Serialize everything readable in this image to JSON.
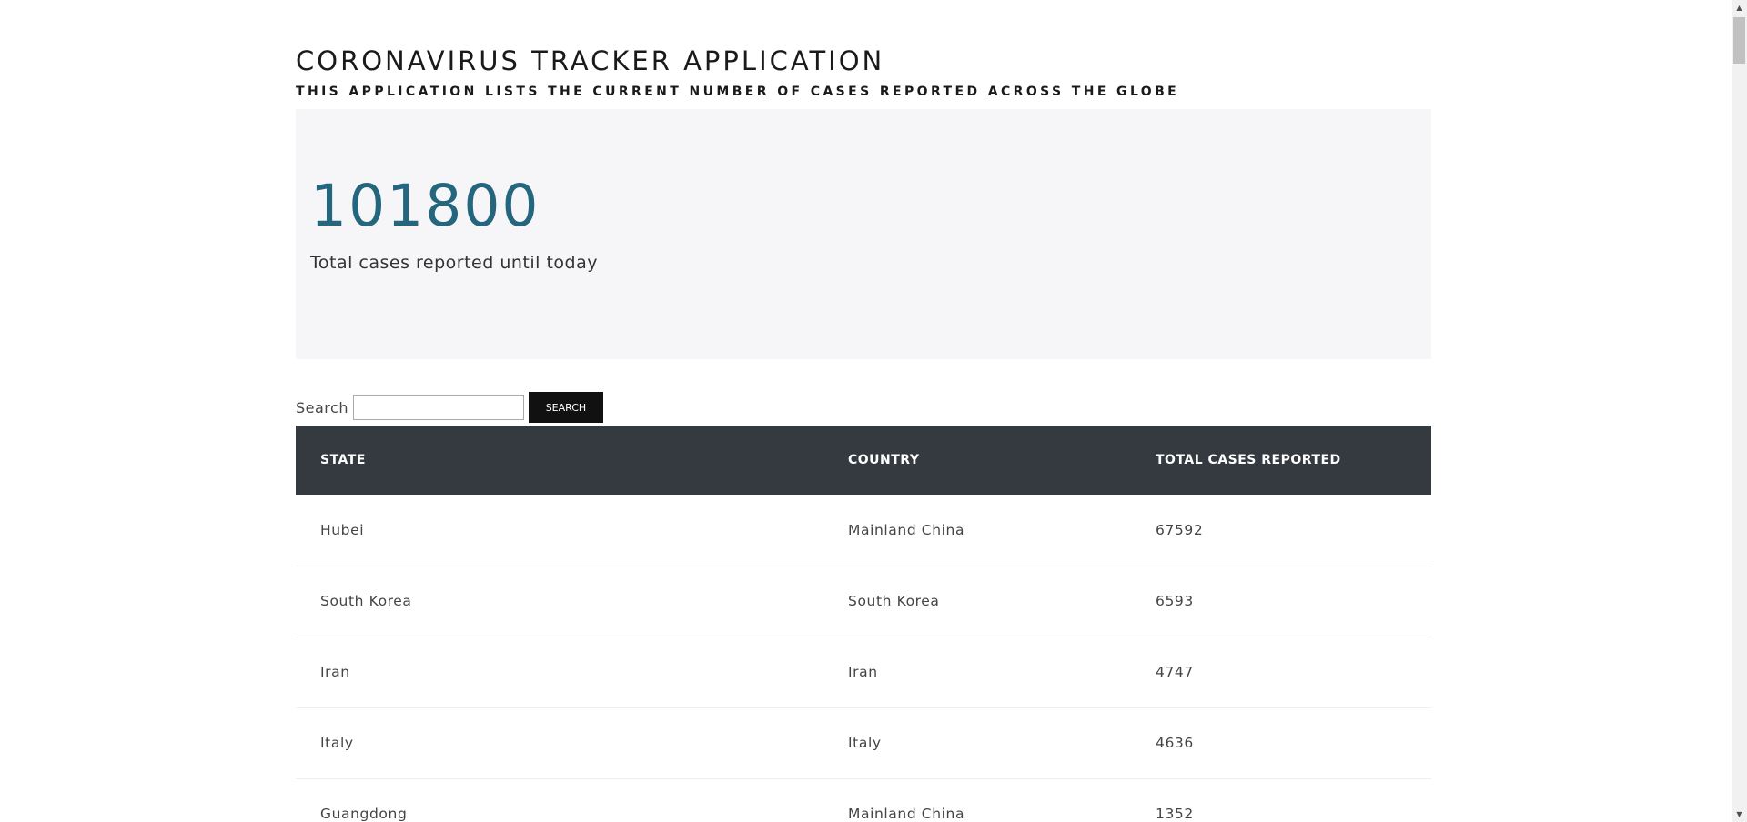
{
  "header": {
    "title": "CORONAVIRUS TRACKER APPLICATION",
    "subtitle": "THIS APPLICATION LISTS THE CURRENT NUMBER OF CASES REPORTED ACROSS THE GLOBE"
  },
  "summary": {
    "total_cases": "101800",
    "total_label": "Total cases reported until today"
  },
  "search": {
    "label": "Search",
    "value": "",
    "placeholder": "",
    "button_label": "SEARCH"
  },
  "table": {
    "headers": {
      "state": "STATE",
      "country": "COUNTRY",
      "total": "TOTAL CASES REPORTED"
    },
    "rows": [
      {
        "state": "Hubei",
        "country": "Mainland China",
        "total": "67592"
      },
      {
        "state": "South Korea",
        "country": "South Korea",
        "total": "6593"
      },
      {
        "state": "Iran",
        "country": "Iran",
        "total": "4747"
      },
      {
        "state": "Italy",
        "country": "Italy",
        "total": "4636"
      },
      {
        "state": "Guangdong",
        "country": "Mainland China",
        "total": "1352"
      }
    ]
  },
  "colors": {
    "accent": "#24667e",
    "table_header_bg": "#343a40",
    "jumbotron_bg": "#f6f6f8",
    "button_bg": "#111111"
  },
  "icons": {
    "scroll_up": "scroll-up-arrow-icon",
    "scroll_down": "scroll-down-arrow-icon"
  }
}
